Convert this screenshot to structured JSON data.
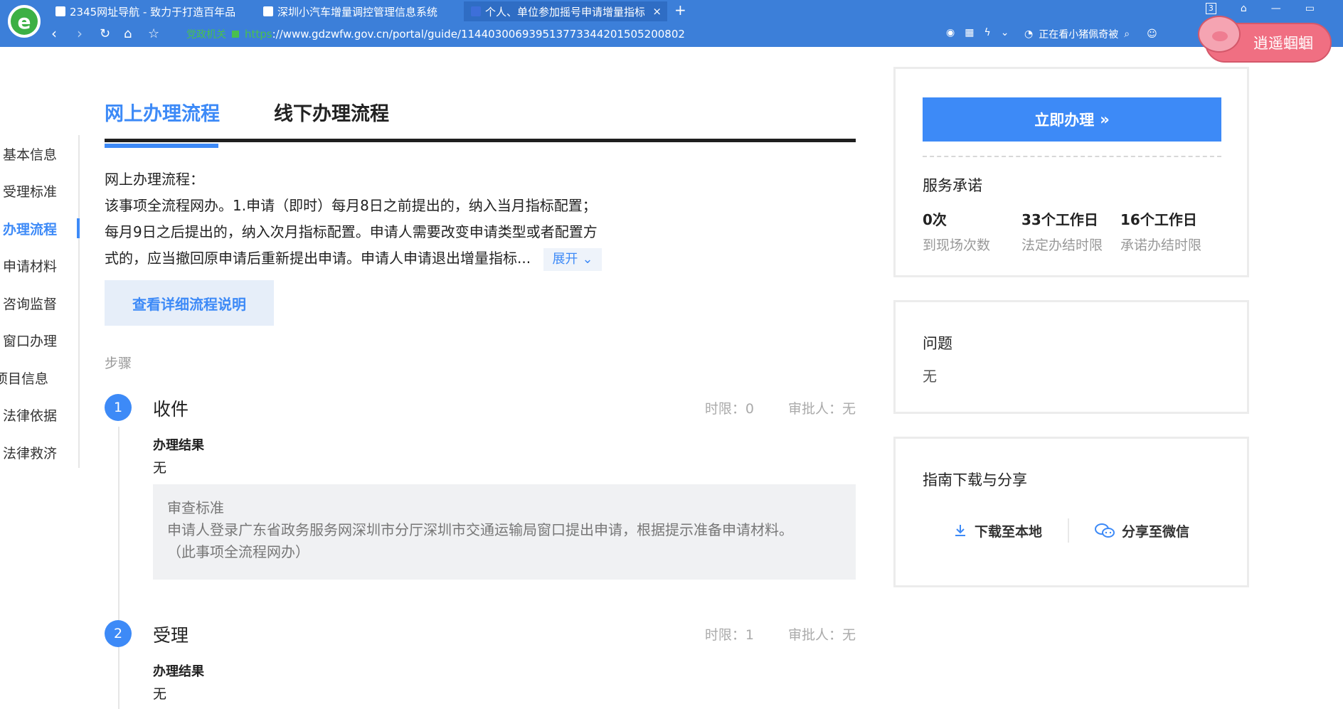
{
  "browser": {
    "logo_letter": "e",
    "tabs": [
      {
        "title": "2345网址导航 - 致力于打造百年品"
      },
      {
        "title": "深圳小汽车增量调控管理信息系统"
      },
      {
        "title": "个人、单位参加摇号申请增量指标"
      }
    ],
    "tab_close": "×",
    "new_tab": "+",
    "tab_count": "3",
    "secure_label": "党政机关",
    "url_scheme": "https",
    "url": "://www.gdzwfw.gov.cn/portal/guide/11440300693951377334420150520080​2",
    "ticker": "正在看小猪佩奇被",
    "mascot_text": "逍遥蝈蝈"
  },
  "leftnav": {
    "items": [
      {
        "label": "基本信息"
      },
      {
        "label": "受理标准"
      },
      {
        "label": "办理流程"
      },
      {
        "label": "申请材料"
      },
      {
        "label": "咨询监督"
      },
      {
        "label": "窗口办理"
      },
      {
        "label": "项目信息"
      },
      {
        "label": "法律依据"
      },
      {
        "label": "法律救济"
      }
    ]
  },
  "main": {
    "tabs": [
      {
        "label": "网上办理流程"
      },
      {
        "label": "线下办理流程"
      }
    ],
    "desc_title": "网上办理流程：",
    "desc_line1": "该事项全流程网办。1.申请（即时）每月8日之前提出的，纳入当月指标配置；",
    "desc_line2": "每月9日之后提出的，纳入次月指标配置。申请人需要改变申请类型或者配置方",
    "desc_line3": "式的，应当撤回原申请后重新提出申请。申请人申请退出增量指标...",
    "expand_label": "展开",
    "detail_button": "查看详细流程说明",
    "steps_label": "步骤",
    "steps": [
      {
        "num": "1",
        "title": "收件",
        "time_limit": "时限：0",
        "approver": "审批人：无",
        "result_label": "办理结果",
        "result_value": "无",
        "criteria_title": "审查标准",
        "criteria_text": "申请人登录广东省政务服务网深圳市分厅深圳市交通运输局窗口提出申请，根据提示准备申请材料。",
        "criteria_note": "（此事项全流程网办）"
      },
      {
        "num": "2",
        "title": "受理",
        "time_limit": "时限：1",
        "approver": "审批人：无",
        "result_label": "办理结果",
        "result_value": "无"
      }
    ]
  },
  "side": {
    "apply_button": "立即办理",
    "apply_arrow": "»",
    "promise_title": "服务承诺",
    "stats": [
      {
        "value": "0次",
        "label": "到现场次数"
      },
      {
        "value": "33个工作日",
        "label": "法定办结时限"
      },
      {
        "value": "16个工作日",
        "label": "承诺办结时限"
      }
    ],
    "question_title": "问题",
    "question_value": "无",
    "share_title": "指南下载与分享",
    "download_label": "下载至本地",
    "wechat_label": "分享至微信"
  },
  "colors": {
    "accent": "#3d8af7",
    "browser_blue": "#3c7fd9",
    "secure_green": "#49c04f"
  }
}
